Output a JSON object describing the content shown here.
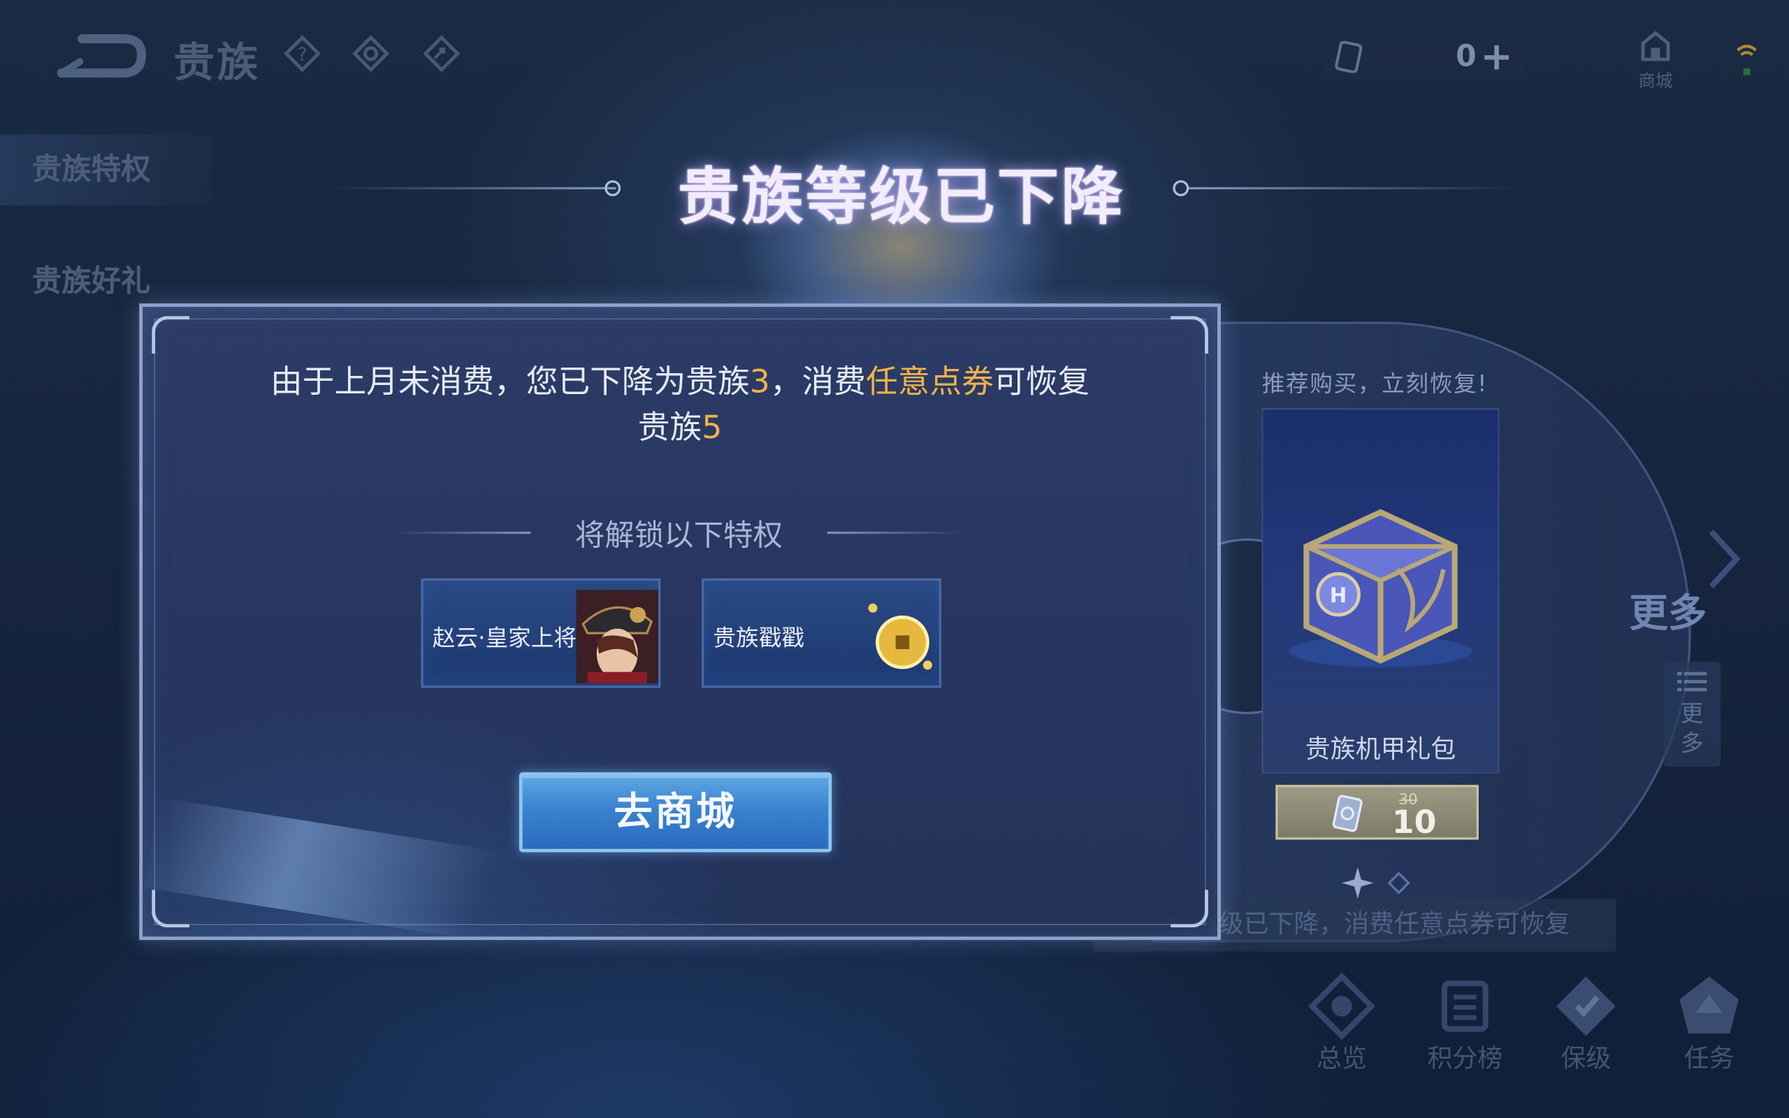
{
  "header": {
    "title": "贵族",
    "icons": [
      "back-icon",
      "help-icon",
      "settings-icon",
      "share-icon"
    ],
    "currency_value": "0",
    "currency_plus": "+",
    "shop_label": "商城"
  },
  "sidebar": {
    "tabs": [
      {
        "label": "贵族特权",
        "selected": true
      },
      {
        "label": "贵族好礼",
        "selected": false
      }
    ]
  },
  "title": "贵族等级已下降",
  "modal": {
    "message_line1_a": "由于上月未消费，您已下降为贵族",
    "message_level_now": "3",
    "message_line1_b": "，消费",
    "message_highlight": "任意点券",
    "message_line1_c": "可恢复",
    "message_line2_a": "贵族",
    "message_level_restore": "5",
    "unlock_label": "将解锁以下特权",
    "privileges": [
      {
        "label": "赵云·皇家上将",
        "art": "hero-portrait"
      },
      {
        "label": "贵族戳戳",
        "art": "gold-coin"
      }
    ],
    "button_label": "去商城"
  },
  "recommend": {
    "title": "推荐购买，立刻恢复!",
    "item_name": "贵族机甲礼包",
    "price_old": "30",
    "price_new": "10",
    "more_label": "更多",
    "notice": "级已下降，消费任意点券可恢复"
  },
  "bottom_nav": [
    {
      "label": "总览",
      "icon": "overview-icon"
    },
    {
      "label": "积分榜",
      "icon": "ranking-icon"
    },
    {
      "label": "保级",
      "icon": "protect-icon"
    },
    {
      "label": "任务",
      "icon": "task-icon"
    }
  ],
  "colors": {
    "highlight": "#f3b24a",
    "button": "#3a83cf",
    "modal_border": "#8ea3cc"
  }
}
